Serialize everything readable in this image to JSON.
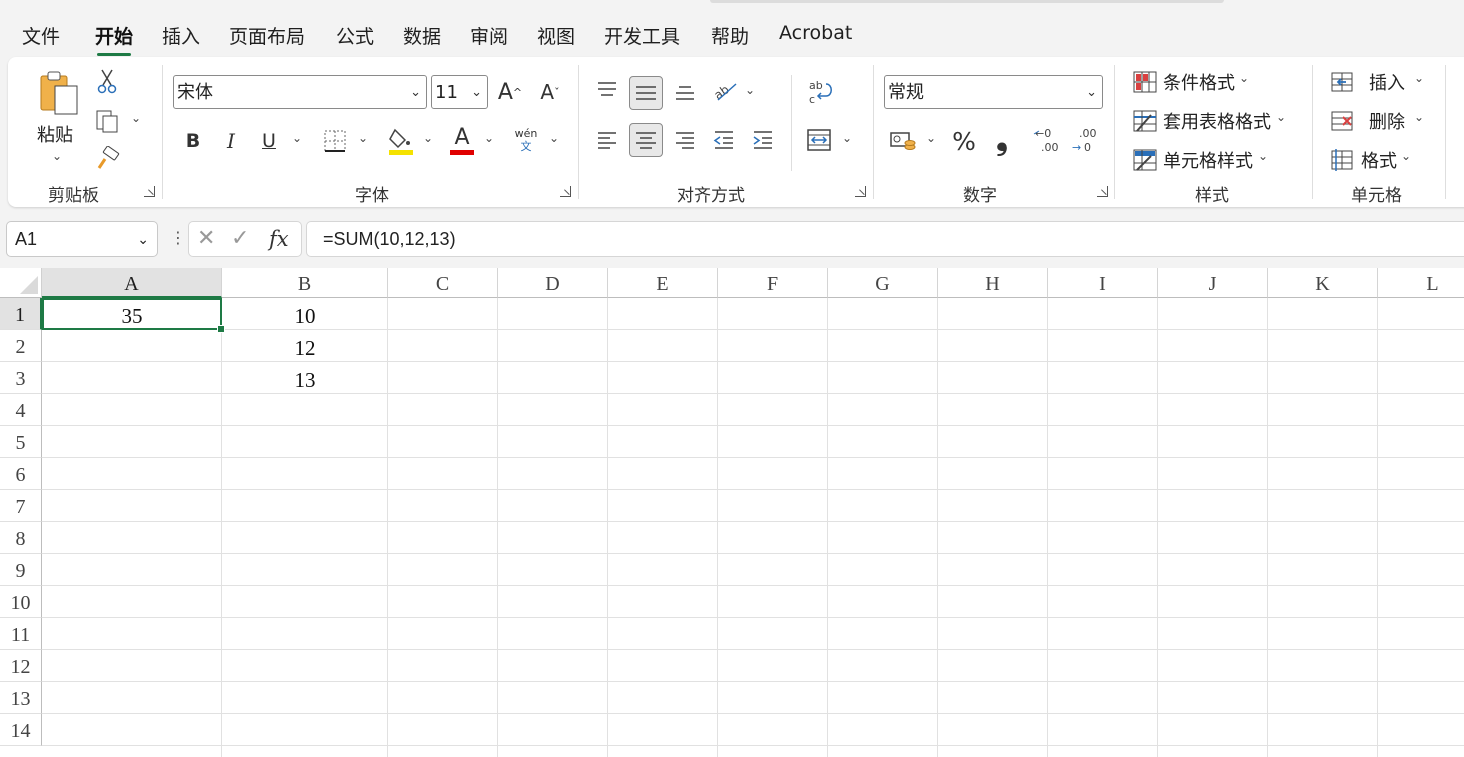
{
  "menu": {
    "tabs": [
      "文件",
      "开始",
      "插入",
      "页面布局",
      "公式",
      "数据",
      "审阅",
      "视图",
      "开发工具",
      "帮助",
      "Acrobat"
    ],
    "active_tab": "开始"
  },
  "ribbon": {
    "clipboard": {
      "paste_label": "粘贴",
      "group_label": "剪贴板"
    },
    "font": {
      "font_name": "宋体",
      "font_size": "11",
      "bold": "B",
      "italic": "I",
      "underline": "U",
      "phonetic_top": "wén",
      "phonetic_bottom": "文",
      "group_label": "字体",
      "highlight_color": "#f5e200",
      "font_color": "#e00000"
    },
    "alignment": {
      "group_label": "对齐方式"
    },
    "number": {
      "format": "常规",
      "percent": "%",
      "comma": "❟",
      "group_label": "数字"
    },
    "styles": {
      "conditional": "条件格式",
      "table_format": "套用表格格式",
      "cell_style": "单元格样式",
      "group_label": "样式"
    },
    "cells": {
      "insert": "插入",
      "delete": "删除",
      "format": "格式",
      "group_label": "单元格"
    }
  },
  "formula_bar": {
    "name_box": "A1",
    "fx": "fx",
    "formula": "=SUM(10,12,13)"
  },
  "sheet": {
    "columns": [
      "A",
      "B",
      "C",
      "D",
      "E",
      "F",
      "G",
      "H",
      "I",
      "J",
      "K",
      "L"
    ],
    "rows": [
      "1",
      "2",
      "3",
      "4",
      "5",
      "6",
      "7",
      "8",
      "9",
      "10",
      "11",
      "12",
      "13",
      "14"
    ],
    "selected_cell": "A1",
    "cells": {
      "A1": "35",
      "B1": "10",
      "B2": "12",
      "B3": "13"
    },
    "accent_color": "#1e7a45"
  }
}
